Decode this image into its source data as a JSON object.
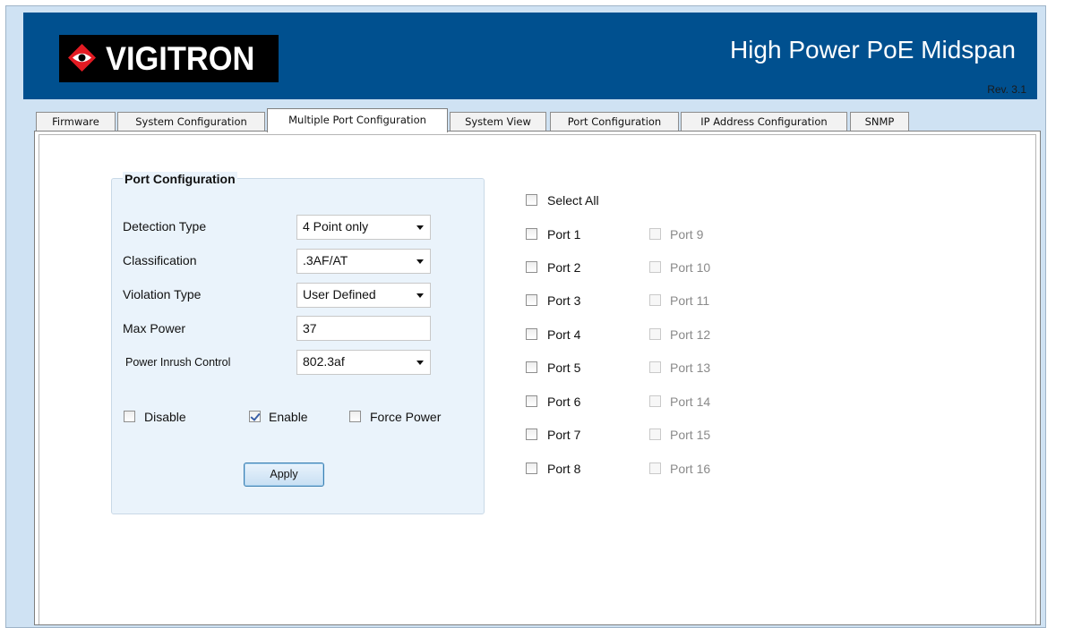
{
  "header": {
    "logo_text": "VIGITRON",
    "title": "High Power PoE Midspan",
    "revision": "Rev. 3.1",
    "colors": {
      "banner": "#00508f",
      "logo_bg": "#000000",
      "logo_accent": "#e31b23"
    }
  },
  "tabs": [
    {
      "label": "Firmware",
      "active": false
    },
    {
      "label": "System Configuration",
      "active": false
    },
    {
      "label": "Multiple Port Configuration",
      "active": true
    },
    {
      "label": "System View",
      "active": false
    },
    {
      "label": "Port Configuration",
      "active": false
    },
    {
      "label": "IP Address Configuration",
      "active": false
    },
    {
      "label": "SNMP",
      "active": false
    }
  ],
  "port_config": {
    "group_title": "Port Configuration",
    "detection_type": {
      "label": "Detection Type",
      "value": "4 Point only"
    },
    "classification": {
      "label": "Classification",
      "value": ".3AF/AT"
    },
    "violation_type": {
      "label": "Violation Type",
      "value": "User Defined"
    },
    "max_power": {
      "label": "Max Power",
      "value": "37"
    },
    "power_inrush": {
      "label": "Power Inrush Control",
      "value": "802.3af"
    },
    "disable": {
      "label": "Disable",
      "checked": false
    },
    "enable": {
      "label": "Enable",
      "checked": true
    },
    "force_power": {
      "label": "Force Power",
      "checked": false
    },
    "apply_label": "Apply"
  },
  "ports": {
    "select_all": {
      "label": "Select All",
      "checked": false
    },
    "left": [
      {
        "label": "Port 1",
        "checked": false,
        "enabled": true
      },
      {
        "label": "Port 2",
        "checked": false,
        "enabled": true
      },
      {
        "label": "Port 3",
        "checked": false,
        "enabled": true
      },
      {
        "label": "Port 4",
        "checked": false,
        "enabled": true
      },
      {
        "label": "Port 5",
        "checked": false,
        "enabled": true
      },
      {
        "label": "Port 6",
        "checked": false,
        "enabled": true
      },
      {
        "label": "Port 7",
        "checked": false,
        "enabled": true
      },
      {
        "label": "Port 8",
        "checked": false,
        "enabled": true
      }
    ],
    "right": [
      {
        "label": "Port 9",
        "checked": false,
        "enabled": false
      },
      {
        "label": "Port 10",
        "checked": false,
        "enabled": false
      },
      {
        "label": "Port 11",
        "checked": false,
        "enabled": false
      },
      {
        "label": "Port 12",
        "checked": false,
        "enabled": false
      },
      {
        "label": "Port 13",
        "checked": false,
        "enabled": false
      },
      {
        "label": "Port 14",
        "checked": false,
        "enabled": false
      },
      {
        "label": "Port 15",
        "checked": false,
        "enabled": false
      },
      {
        "label": "Port 16",
        "checked": false,
        "enabled": false
      }
    ]
  }
}
